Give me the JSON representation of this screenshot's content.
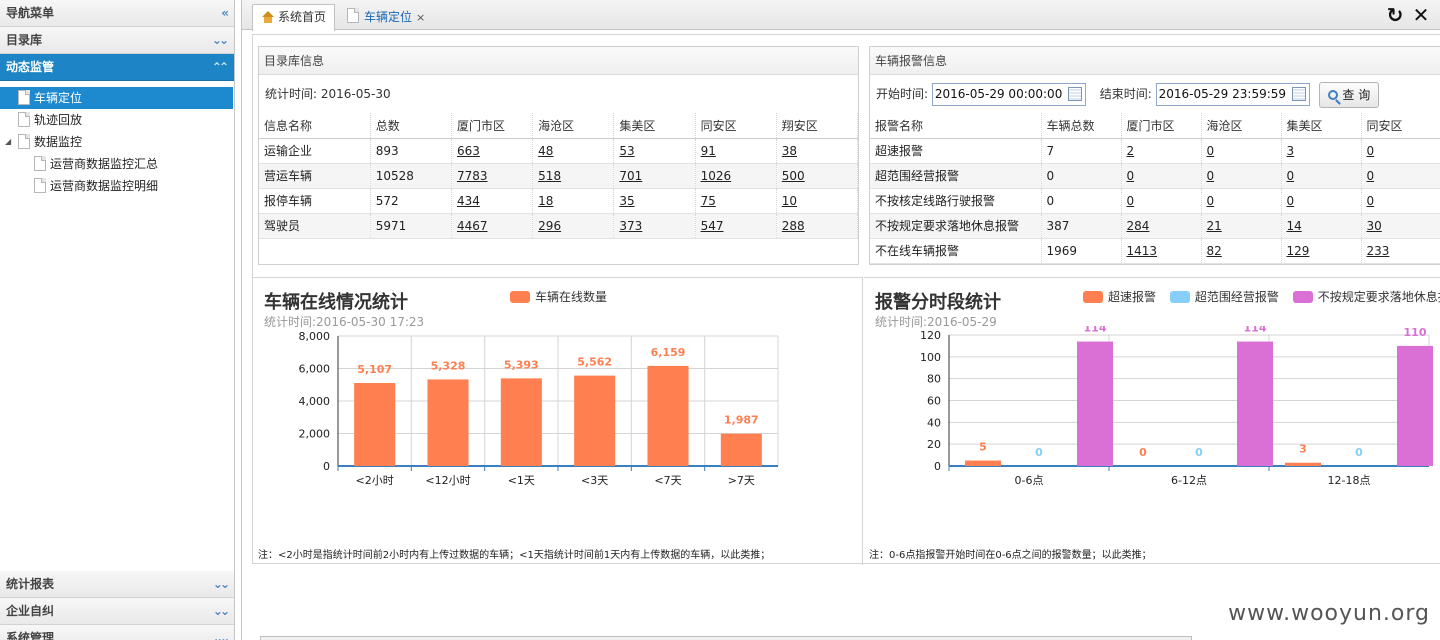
{
  "sidebar": {
    "header": "导航菜单",
    "sections": [
      "目录库",
      "动态监管"
    ],
    "tree": [
      "车辆定位",
      "轨迹回放",
      "数据监控",
      "运营商数据监控汇总",
      "运营商数据监控明细"
    ],
    "bottom": [
      "统计报表",
      "企业自纠",
      "系统管理"
    ]
  },
  "tabs": [
    "系统首页",
    "车辆定位"
  ],
  "catalog": {
    "title": "目录库信息",
    "stat": "统计时间: 2016-05-30",
    "header": [
      "信息名称",
      "总数",
      "厦门市区",
      "海沧区",
      "集美区",
      "同安区",
      "翔安区"
    ],
    "rows": [
      [
        "运输企业",
        "893",
        "663",
        "48",
        "53",
        "91",
        "38"
      ],
      [
        "营运车辆",
        "10528",
        "7783",
        "518",
        "701",
        "1026",
        "500"
      ],
      [
        "报停车辆",
        "572",
        "434",
        "18",
        "35",
        "75",
        "10"
      ],
      [
        "驾驶员",
        "5971",
        "4467",
        "296",
        "373",
        "547",
        "288"
      ]
    ]
  },
  "alarm": {
    "title": "车辆报警信息",
    "start_label": "开始时间:",
    "start_value": "2016-05-29 00:00:00",
    "end_label": "结束时间:",
    "end_value": "2016-05-29 23:59:59",
    "query": "查 询",
    "header": [
      "报警名称",
      "车辆总数",
      "厦门市区",
      "海沧区",
      "集美区",
      "同安区"
    ],
    "rows": [
      [
        "超速报警",
        "7",
        "2",
        "0",
        "3",
        "0"
      ],
      [
        "超范围经营报警",
        "0",
        "0",
        "0",
        "0",
        "0"
      ],
      [
        "不按核定线路行驶报警",
        "0",
        "0",
        "0",
        "0",
        "0"
      ],
      [
        "不按规定要求落地休息报警",
        "387",
        "284",
        "21",
        "14",
        "30"
      ],
      [
        "不在线车辆报警",
        "1969",
        "1413",
        "82",
        "129",
        "233"
      ]
    ]
  },
  "chart_data": [
    {
      "type": "bar",
      "title": "车辆在线情况统计",
      "subtitle": "统计时间:2016-05-30 17:23",
      "categories": [
        "<2小时",
        "<12小时",
        "<1天",
        "<3天",
        "<7天",
        ">7天"
      ],
      "series": [
        {
          "name": "车辆在线数量",
          "values": [
            5107,
            5328,
            5393,
            5562,
            6159,
            1987
          ],
          "color": "#ff7f50"
        }
      ],
      "ylim": [
        0,
        8000
      ],
      "yticks": [
        "0",
        "2,000",
        "4,000",
        "6,000",
        "8,000"
      ],
      "labels": [
        "5,107",
        "5,328",
        "5,393",
        "5,562",
        "6,159",
        "1,987"
      ],
      "note": "注：<2小时是指统计时间前2小时内有上传过数据的车辆；<1天指统计时间前1天内有上传数据的车辆，以此类推；"
    },
    {
      "type": "bar",
      "title": "报警分时段统计",
      "subtitle": "统计时间:2016-05-29",
      "categories": [
        "0-6点",
        "6-12点",
        "12-18点"
      ],
      "series": [
        {
          "name": "超速报警",
          "values": [
            5,
            0,
            3
          ],
          "color": "#ff7f50"
        },
        {
          "name": "超范围经营报警",
          "values": [
            0,
            0,
            0
          ],
          "color": "#87cefa"
        },
        {
          "name": "不按规定要求落地休息报",
          "values": [
            114,
            114,
            110
          ],
          "color": "#da70d6"
        }
      ],
      "ylim": [
        0,
        120
      ],
      "yticks": [
        "0",
        "20",
        "40",
        "60",
        "80",
        "100",
        "120"
      ],
      "note": "注：0-6点指报警开始时间在0-6点之间的报警数量；以此类推；"
    }
  ],
  "watermark": "www.wooyun.org"
}
